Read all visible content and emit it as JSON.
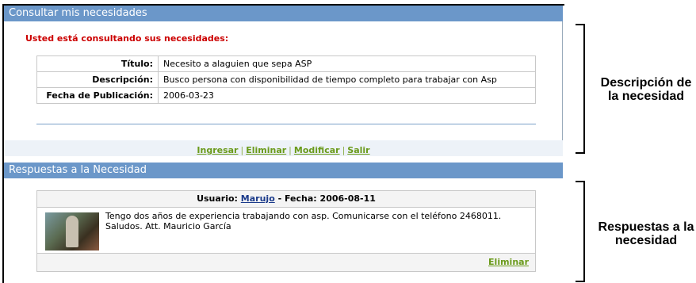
{
  "panel1": {
    "title": "Consultar mis necesidades",
    "heading": "Usted está consultando sus necesidades:",
    "rows": [
      {
        "label": "Título:",
        "value": "Necesito a alaguien que sepa ASP"
      },
      {
        "label": "Descripción:",
        "value": "Busco persona con disponibilidad de tiempo completo para trabajar con Asp"
      },
      {
        "label": "Fecha de Publicación:",
        "value": "2006-03-23"
      }
    ],
    "actions": [
      "Ingresar",
      "Eliminar",
      "Modificar",
      "Salir"
    ],
    "separator": "|"
  },
  "panel2": {
    "title": "Respuestas a la Necesidad",
    "response": {
      "user_prefix": "Usuario:",
      "user": "Marujo",
      "date_prefix": "- Fecha:",
      "date": "2006-08-11",
      "text": "Tengo dos años de experiencia trabajando con asp. Comunicarse con el teléfono 2468011. Saludos. Att. Mauricio García",
      "delete_label": "Eliminar"
    }
  },
  "annotations": {
    "label1": "Descripción de la necesidad",
    "label2": "Respuestas a la necesidad"
  }
}
